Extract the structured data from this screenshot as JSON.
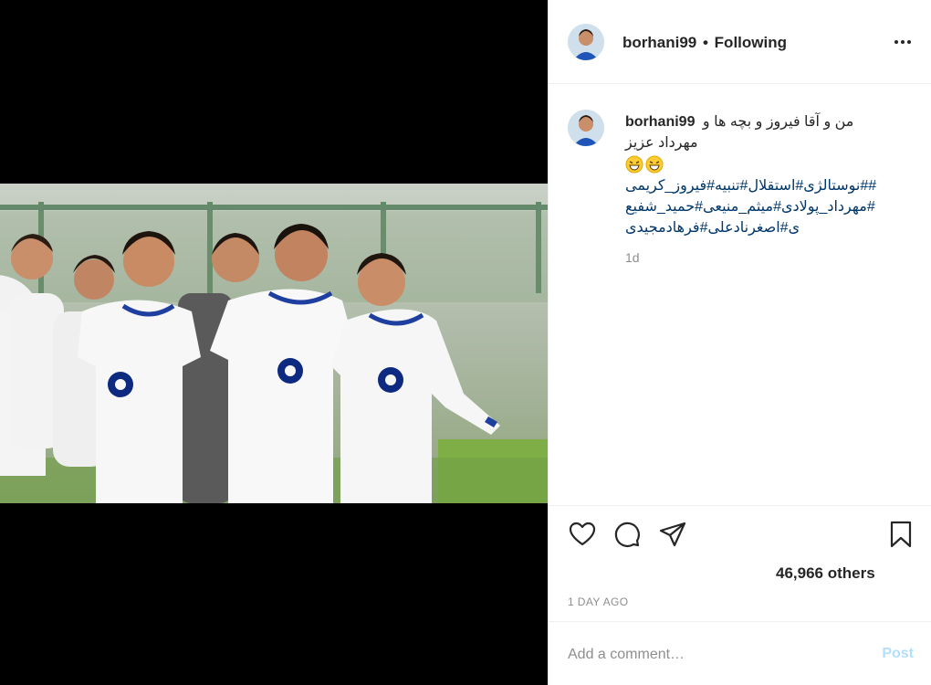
{
  "post": {
    "username": "borhani99",
    "separator": "•",
    "follow_status": "Following",
    "more_label": "More options"
  },
  "caption": {
    "username": "borhani99",
    "line1": "من و آقا فیروز و بچه ها و",
    "line2": "مهرداد عزیز",
    "emoji": [
      "😁",
      "😁"
    ],
    "hashtags": [
      "##نوستالژی#استقلال#تنبیه#فیروز_کریمی",
      "#مهرداد_پولادی#میثم_منیعی#حمید_شفیع",
      "ی#اصغرنادعلی#فرهادمجیدی"
    ],
    "relative_time": "1d"
  },
  "actions": {
    "like_icon": "heart-icon",
    "comment_icon": "speech-bubble-icon",
    "share_icon": "paper-plane-icon",
    "save_icon": "bookmark-icon"
  },
  "likes_text": "46,966 others",
  "timestamp": "1 DAY AGO",
  "comment": {
    "placeholder": "Add a comment…",
    "post_label": "Post"
  },
  "colors": {
    "hashtag": "#00376b",
    "post_disabled": "#b2dffc",
    "muted": "#8e8e8e"
  }
}
